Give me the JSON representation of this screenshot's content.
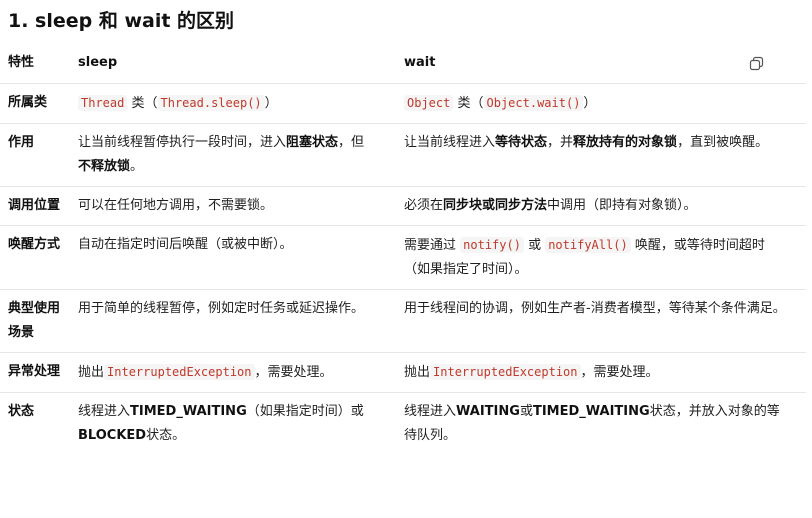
{
  "title": "1. sleep 和 wait 的区别",
  "header": {
    "feature": "特性",
    "sleep": "sleep",
    "wait": "wait"
  },
  "rows": [
    {
      "key": "所属类",
      "sleep": {
        "code1": "Thread",
        "t1": " 类（",
        "code2": "Thread.sleep()",
        "t2": "）"
      },
      "wait": {
        "code1": "Object",
        "t1": " 类（",
        "code2": "Object.wait()",
        "t2": "）"
      }
    },
    {
      "key": "作用",
      "sleep": {
        "t1": "让当前线程暂停执行一段时间，进入",
        "b1": "阻塞状态",
        "t2": "，但",
        "b2": "不释放锁",
        "t3": "。"
      },
      "wait": {
        "t1": "让当前线程进入",
        "b1": "等待状态",
        "t2": "，并",
        "b2": "释放持有的对象锁",
        "t3": "，直到被唤醒。"
      }
    },
    {
      "key": "调用位置",
      "sleep": {
        "t1": "可以在任何地方调用，不需要锁。"
      },
      "wait": {
        "t1": "必须在",
        "b1": "同步块或同步方法",
        "t2": "中调用（即持有对象锁）。"
      }
    },
    {
      "key": "唤醒方式",
      "sleep": {
        "t1": "自动在指定时间后唤醒（或被中断）。"
      },
      "wait": {
        "t1": "需要通过 ",
        "code1": "notify()",
        "t2": " 或 ",
        "code2": "notifyAll()",
        "t3": " 唤醒，或等待时间超时（如果指定了时间）。"
      }
    },
    {
      "key": "典型使用场景",
      "sleep": {
        "t1": "用于简单的线程暂停，例如定时任务或延迟操作。"
      },
      "wait": {
        "t1": "用于线程间的协调，例如生产者-消费者模型，等待某个条件满足。"
      }
    },
    {
      "key": "异常处理",
      "sleep": {
        "t1": "抛出",
        "code1": "InterruptedException",
        "t2": "，需要处理。"
      },
      "wait": {
        "t1": "抛出",
        "code1": "InterruptedException",
        "t2": "，需要处理。"
      }
    },
    {
      "key": "状态",
      "sleep": {
        "t1": "线程进入",
        "b1": "TIMED_WAITING",
        "t2": "（如果指定时间）或",
        "b2": "BLOCKED",
        "t3": "状态。"
      },
      "wait": {
        "t1": "线程进入",
        "b1": "WAITING",
        "t2": "或",
        "b2": "TIMED_WAITING",
        "t3": "状态，并放入对象的等待队列。"
      }
    }
  ],
  "icons": {
    "copy": "copy-icon"
  }
}
